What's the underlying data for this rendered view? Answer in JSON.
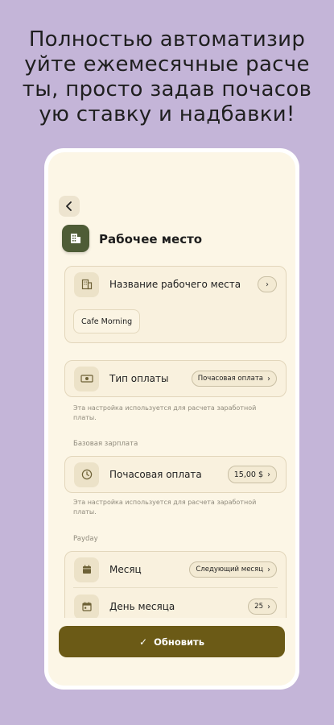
{
  "promo": {
    "headline": "Полностью автоматизир\nуйте ежемесячные расче\nты, просто задав почасов\nую ставку и надбавки!"
  },
  "header": {
    "title": "Рабочее место"
  },
  "workplace": {
    "label": "Название рабочего места",
    "value": "Cafe Morning"
  },
  "payment_type": {
    "label": "Тип оплаты",
    "value": "Почасовая оплата",
    "hint": "Эта настройка используется для расчета заработной платы."
  },
  "base_salary": {
    "section_title": "Базовая зарплата",
    "label": "Почасовая оплата",
    "value": "15,00 $",
    "hint": "Эта настройка используется для расчета заработной платы."
  },
  "payday": {
    "section_title": "Payday",
    "month_label": "Месяц",
    "month_value": "Следующий месяц",
    "day_label": "День месяца",
    "day_value": "25"
  },
  "footer": {
    "update_label": "Обновить"
  },
  "colors": {
    "background": "#c4b5d8",
    "screen": "#fcf6e6",
    "accent_button": "#6b5a16",
    "header_icon": "#4e5c36"
  }
}
